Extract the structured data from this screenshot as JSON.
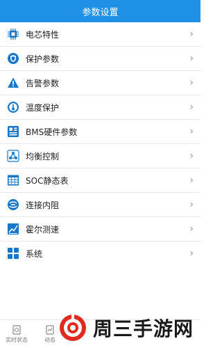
{
  "header": {
    "title": "参数设置"
  },
  "menu": {
    "items": [
      {
        "label": "电芯特性",
        "icon": "chip-icon"
      },
      {
        "label": "保护参数",
        "icon": "shield-icon"
      },
      {
        "label": "告警参数",
        "icon": "warning-icon"
      },
      {
        "label": "温度保护",
        "icon": "temperature-gauge-icon"
      },
      {
        "label": "BMS硬件参数",
        "icon": "hardware-grid-icon"
      },
      {
        "label": "均衡控制",
        "icon": "balance-network-icon"
      },
      {
        "label": "SOC静态表",
        "icon": "table-icon"
      },
      {
        "label": "连接内阻",
        "icon": "resistance-icon"
      },
      {
        "label": "霍尔测速",
        "icon": "speed-chart-icon"
      },
      {
        "label": "系统",
        "icon": "system-grid-icon"
      }
    ]
  },
  "tabbar": {
    "items": [
      {
        "label": "实时状态",
        "icon": "realtime-icon"
      },
      {
        "label": "动态",
        "icon": "dynamic-icon"
      }
    ]
  },
  "watermark": {
    "text": "周三手游网"
  },
  "colors": {
    "header_bg": "#1e90e6",
    "icon_blue": "#1877c9",
    "watermark_red": "#e12a1d"
  }
}
